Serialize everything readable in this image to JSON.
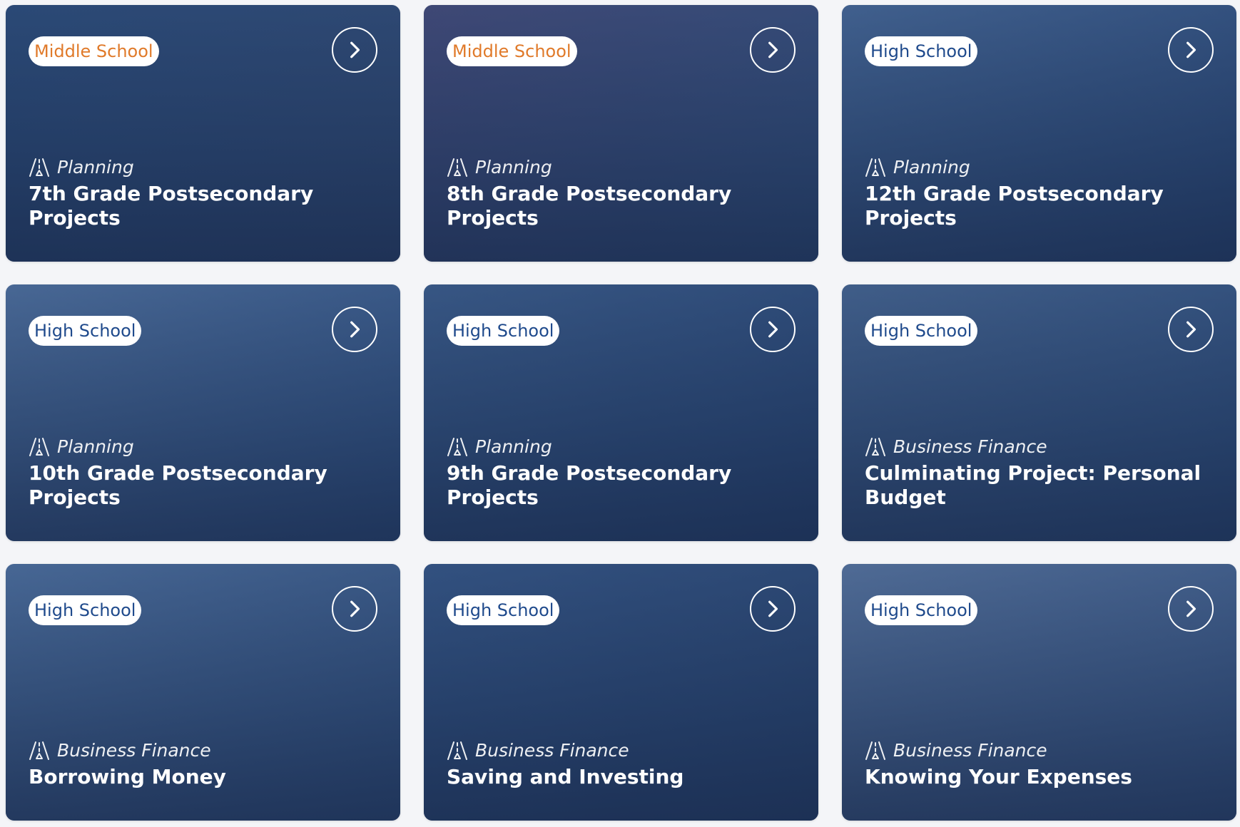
{
  "cards": [
    {
      "badge": "Middle School",
      "badge_type": "ms",
      "category": "Planning",
      "title": "7th Grade Postsecondary Projects",
      "photo_colors": [
        "#2e4d7a",
        "#3a4a6e"
      ]
    },
    {
      "badge": "Middle School",
      "badge_type": "ms",
      "category": "Planning",
      "title": "8th Grade Postsecondary Projects",
      "photo_colors": [
        "#5a4a78",
        "#3a5680"
      ]
    },
    {
      "badge": "High School",
      "badge_type": "hs",
      "category": "Planning",
      "title": "12th Grade Postsecondary Projects",
      "photo_colors": [
        "#5e7fae",
        "#2f4a78"
      ]
    },
    {
      "badge": "High School",
      "badge_type": "hs",
      "category": "Planning",
      "title": "10th Grade Postsecondary Projects",
      "photo_colors": [
        "#6f90bd",
        "#3b5b8c"
      ]
    },
    {
      "badge": "High School",
      "badge_type": "hs",
      "category": "Planning",
      "title": "9th Grade Postsecondary Projects",
      "photo_colors": [
        "#4a6a98",
        "#2b4470"
      ]
    },
    {
      "badge": "High School",
      "badge_type": "hs",
      "category": "Business Finance",
      "title": "Culminating Project: Personal Budget",
      "photo_colors": [
        "#5d7aa3",
        "#33507c"
      ]
    },
    {
      "badge": "High School",
      "badge_type": "hs",
      "category": "Business Finance",
      "title": "Borrowing Money",
      "photo_colors": [
        "#6d8fbd",
        "#3e5a86"
      ]
    },
    {
      "badge": "High School",
      "badge_type": "hs",
      "category": "Business Finance",
      "title": "Saving and Investing",
      "photo_colors": [
        "#3f5f90",
        "#2a3f66"
      ]
    },
    {
      "badge": "High School",
      "badge_type": "hs",
      "category": "Business Finance",
      "title": "Knowing Your Expenses",
      "photo_colors": [
        "#7f98bf",
        "#4a6490"
      ]
    }
  ]
}
